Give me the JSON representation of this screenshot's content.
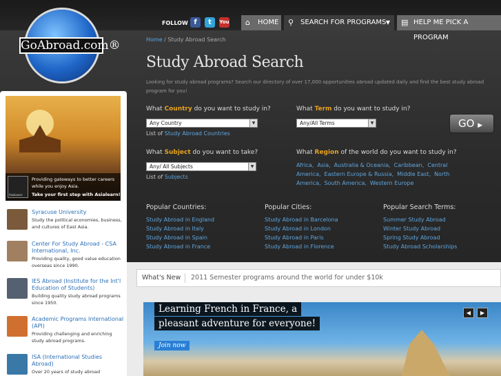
{
  "logo": {
    "text": "GoAbroad.com®"
  },
  "follow": {
    "label": "FOLLOW",
    "facebook_icon": "f",
    "twitter_icon": "t",
    "youtube_icon": "You"
  },
  "nav": {
    "home": "HOME",
    "search": "SEARCH FOR PROGRAMS",
    "help": "HELP ME PICK A PROGRAM"
  },
  "breadcrumb": {
    "home": "Home",
    "sep": " / ",
    "current": "Study Abroad Search"
  },
  "page_title": "Study Abroad Search",
  "intro": "Looking for study abroad programs? Search our directory of over 17,000 opportunities abroad updated daily and find the best study abroad program for you!",
  "country": {
    "pre": "What ",
    "hl": "Country",
    "post": " do you want to study in?",
    "selected": "Any Country",
    "list_pre": "List of ",
    "list_link": "Study Abroad Countries"
  },
  "term": {
    "pre": "What ",
    "hl": "Term",
    "post": " do you want to study in?",
    "selected": "Any/All Terms"
  },
  "subject": {
    "pre": "What ",
    "hl": "Subject",
    "post": " do you want to take?",
    "selected": "Any/ All Subjects",
    "list_pre": "List of ",
    "list_link": "Subjects"
  },
  "region": {
    "pre": "What ",
    "hl": "Region",
    "post": " of the world do you want to study in?",
    "items": [
      "Africa,",
      "Asia,",
      "Australia & Oceania,",
      "Caribbean,",
      "Central America,",
      "Eastern Europe & Russia,",
      "Middle East,",
      "North America,",
      "South America,",
      "Western Europe"
    ]
  },
  "go_button": "GO",
  "popular": {
    "countries": {
      "title": "Popular Countries:",
      "links": [
        "Study Abroad in England",
        "Study Abroad in Italy",
        "Study Abroad in Spain",
        "Study Abroad in France"
      ]
    },
    "cities": {
      "title": "Popular Cities:",
      "links": [
        "Study Abroad in Barcelona",
        "Study Abroad in London",
        "Study Abroad in Paris",
        "Study Abroad in Florence"
      ]
    },
    "terms": {
      "title": "Popular Search Terms:",
      "links": [
        "Summer Study Abroad",
        "Winter Study Abroad",
        "Spring Study Abroad",
        "Study Abroad Scholarships"
      ]
    }
  },
  "sidebar": {
    "ad": {
      "text": "Providing gateways to better careers while you enjoy Asia.",
      "cta": "Take your first step with Asialearn!",
      "logo_text": "AsiaLearn"
    },
    "providers": [
      {
        "name": "Syracuse University",
        "desc": "Study the political economies, business, and cultures of East Asia.",
        "color": "#7a5a3a"
      },
      {
        "name": "Center For Study Abroad - CSA International, Inc.",
        "desc": "Providing quality, good value education overseas since 1990.",
        "color": "#a08060"
      },
      {
        "name": "IES Abroad (Institute for the Int'l Education of Students)",
        "desc": "Building quality study abroad programs since 1950.",
        "color": "#556070"
      },
      {
        "name": "Academic Programs International (API)",
        "desc": "Providing challenging and enriching study abroad programs.",
        "color": "#d07030"
      },
      {
        "name": "ISA (International Studies Abroad)",
        "desc": "Over 20 years of study abroad",
        "color": "#3a78a8"
      }
    ]
  },
  "whats_new": {
    "label": "What's New",
    "text": "2011 Semester programs around the world for under $10k"
  },
  "banner": {
    "line1": "Learning French in France, a",
    "line2": "pleasant adventure for everyone!",
    "join": "Join now",
    "prev": "◀",
    "next": "▶"
  }
}
